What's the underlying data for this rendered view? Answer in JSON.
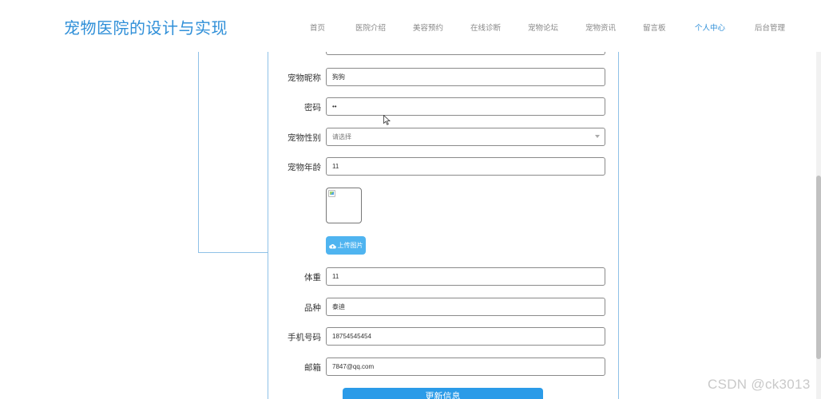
{
  "header": {
    "site_title": "宠物医院的设计与实现",
    "nav": [
      {
        "label": "首页",
        "active": false
      },
      {
        "label": "医院介绍",
        "active": false
      },
      {
        "label": "美容预约",
        "active": false
      },
      {
        "label": "在线诊断",
        "active": false
      },
      {
        "label": "宠物论坛",
        "active": false
      },
      {
        "label": "宠物资讯",
        "active": false
      },
      {
        "label": "留言板",
        "active": false
      },
      {
        "label": "个人中心",
        "active": true
      },
      {
        "label": "后台管理",
        "active": false
      }
    ]
  },
  "form": {
    "pet_nickname": {
      "label": "宠物昵称",
      "value": "狗狗"
    },
    "password": {
      "label": "密码",
      "value": "••"
    },
    "pet_gender": {
      "label": "宠物性别",
      "value": "",
      "placeholder": "请选择"
    },
    "pet_age": {
      "label": "宠物年龄",
      "value": "11"
    },
    "upload_button": "上传图片",
    "weight": {
      "label": "体重",
      "value": "11"
    },
    "breed": {
      "label": "品种",
      "value": "泰迪"
    },
    "phone": {
      "label": "手机号码",
      "value": "18754545454"
    },
    "email": {
      "label": "邮箱",
      "value": "7847@qq.com"
    },
    "submit_button": "更新信息"
  },
  "watermark": "CSDN @ck3013",
  "colors": {
    "brand": "#2f8fd8",
    "nav_active": "#2f8fd8",
    "upload_button": "#4fb4f0",
    "submit_button": "#2b9be8",
    "panel_border": "#8fc1e7"
  },
  "icons": {
    "upload": "cloud-upload-icon",
    "select": "chevron-down-icon",
    "cursor": "mouse-pointer-icon"
  }
}
